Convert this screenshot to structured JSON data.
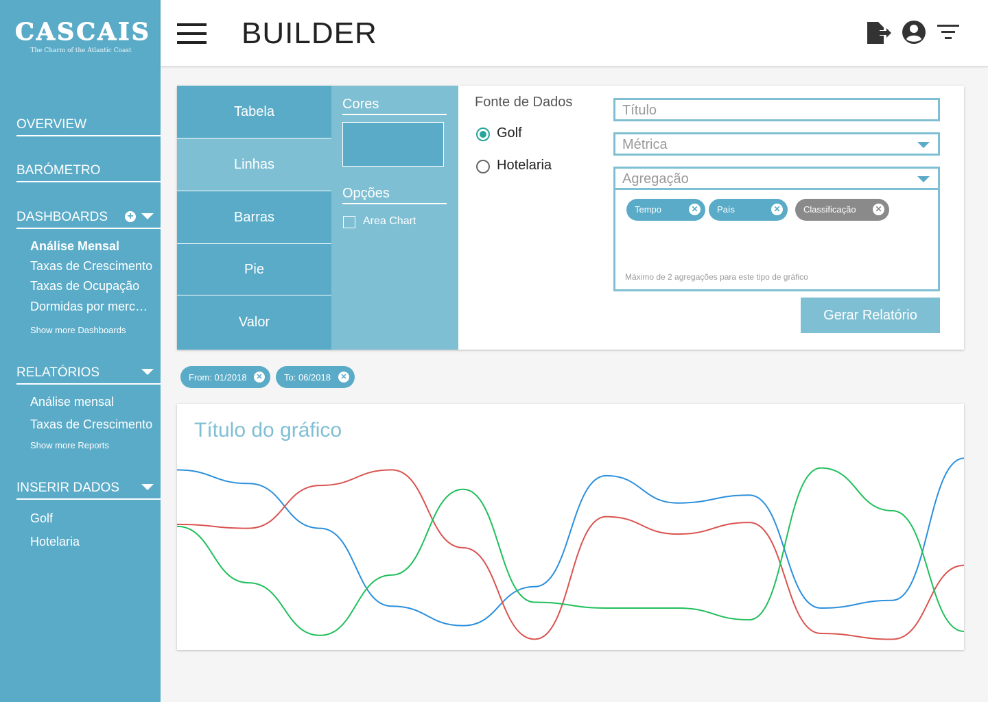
{
  "logo": {
    "brand": "CASCAIS",
    "tagline": "The Charm of the Atlantic Coast"
  },
  "sidebar": {
    "overview": "OVERVIEW",
    "barometro": "BARÓMETRO",
    "dashboards": {
      "label": "DASHBOARDS",
      "items": [
        "Análise Mensal",
        "Taxas de Crescimento",
        "Taxas de Ocupação",
        "Dormidas por mercado"
      ],
      "more": "Show more Dashboards"
    },
    "relatorios": {
      "label": "RELATÓRIOS",
      "items": [
        "Análise mensal",
        "Taxas de Crescimento"
      ],
      "more": "Show more Reports"
    },
    "inserir": {
      "label": "INSERIR DADOS",
      "items": [
        "Golf",
        "Hotelaria"
      ]
    }
  },
  "header": {
    "title": "BUILDER"
  },
  "builder": {
    "chart_types": [
      "Tabela",
      "Linhas",
      "Barras",
      "Pie",
      "Valor"
    ],
    "selected_type": "Linhas",
    "cores_label": "Cores",
    "opcoes_label": "Opções",
    "area_chart_label": "Area Chart",
    "fonte_title": "Fonte de Dados",
    "sources": [
      "Golf",
      "Hotelaria"
    ],
    "selected_source": "Golf",
    "titulo_placeholder": "Título",
    "metrica_placeholder": "Métrica",
    "agregacao_placeholder": "Agregação",
    "aggregations": [
      "Tempo",
      "País",
      "Classificação"
    ],
    "agg_hint": "Máximo de 2 agregações para este tipo de gráfico",
    "generate_label": "Gerar Relatório"
  },
  "filters": [
    "From: 01/2018",
    "To: 06/2018"
  ],
  "chart": {
    "title": "Título do gráfico"
  },
  "colors": {
    "primary": "#5aabc8",
    "light": "#7fbfd3",
    "radio": "#26a69a"
  },
  "chart_data": {
    "type": "line",
    "title": "Título do gráfico",
    "x": [
      0,
      1,
      2,
      3,
      4,
      5,
      6,
      7,
      8,
      9,
      10,
      11
    ],
    "ylim": [
      0,
      100
    ],
    "grid": false,
    "series": [
      {
        "color": "#2b8fdc",
        "values": [
          90,
          83,
          60,
          20,
          10,
          30,
          87,
          73,
          77,
          19,
          23,
          96
        ]
      },
      {
        "color": "#d9534f",
        "values": [
          62,
          60,
          82,
          90,
          50,
          3,
          66,
          57,
          63,
          6,
          3,
          41
        ]
      },
      {
        "color": "#1fbf5a",
        "values": [
          61,
          32,
          5,
          36,
          80,
          22,
          19,
          19,
          13,
          91,
          69,
          7
        ]
      }
    ]
  }
}
